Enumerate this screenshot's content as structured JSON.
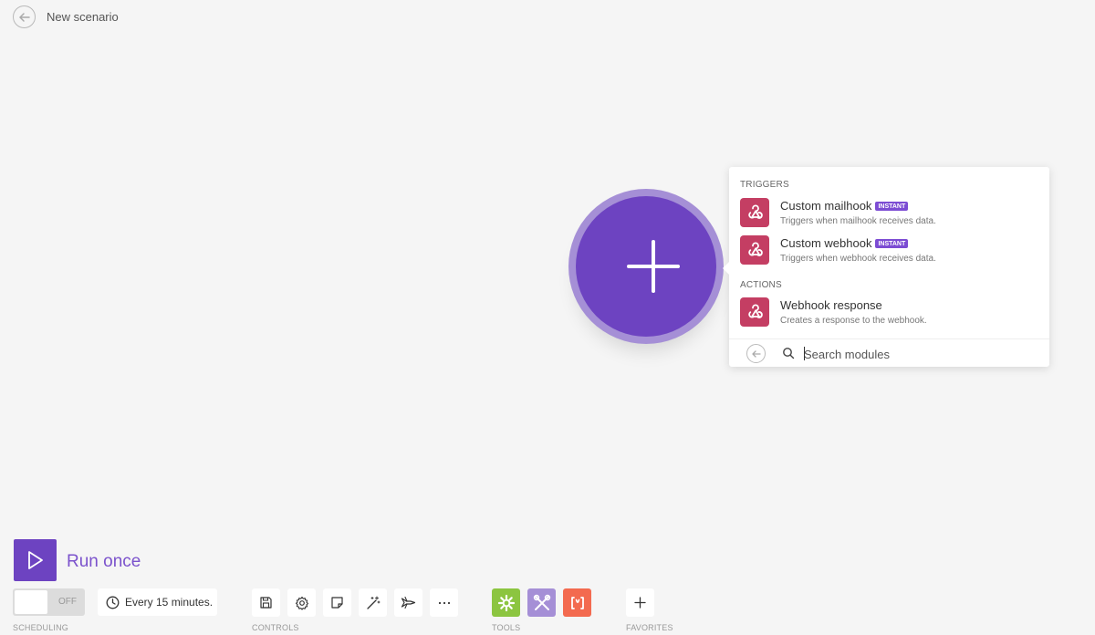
{
  "header": {
    "title": "New scenario"
  },
  "panel": {
    "triggers_title": "TRIGGERS",
    "actions_title": "ACTIONS",
    "triggers": [
      {
        "name": "Custom mailhook",
        "badge": "INSTANT",
        "desc": "Triggers when mailhook receives data."
      },
      {
        "name": "Custom webhook",
        "badge": "INSTANT",
        "desc": "Triggers when webhook receives data."
      }
    ],
    "actions": [
      {
        "name": "Webhook response",
        "desc": "Creates a response to the webhook."
      }
    ],
    "search": {
      "placeholder": "Search modules",
      "value": ""
    }
  },
  "run": {
    "label": "Run once"
  },
  "scheduling": {
    "toggle_label": "OFF",
    "interval": "Every 15 minutes."
  },
  "labels": {
    "scheduling": "SCHEDULING",
    "controls": "CONTROLS",
    "tools": "TOOLS",
    "favorites": "FAVORITES"
  },
  "colors": {
    "brand": "#6d43c1",
    "brand_ring": "#a58fd6",
    "webhook_icon": "#c43e63",
    "instant_badge": "#7c4cd3",
    "tool_flow": "#8cc540",
    "tool_tools": "#a58fd6",
    "tool_text": "#f36a4f"
  },
  "icons": {
    "controls": [
      "save-icon",
      "settings-icon",
      "notes-icon",
      "magic-wand-icon",
      "airplane-icon",
      "more-icon"
    ],
    "tools": [
      "flow-control-icon",
      "tools-icon",
      "text-parser-icon"
    ]
  }
}
